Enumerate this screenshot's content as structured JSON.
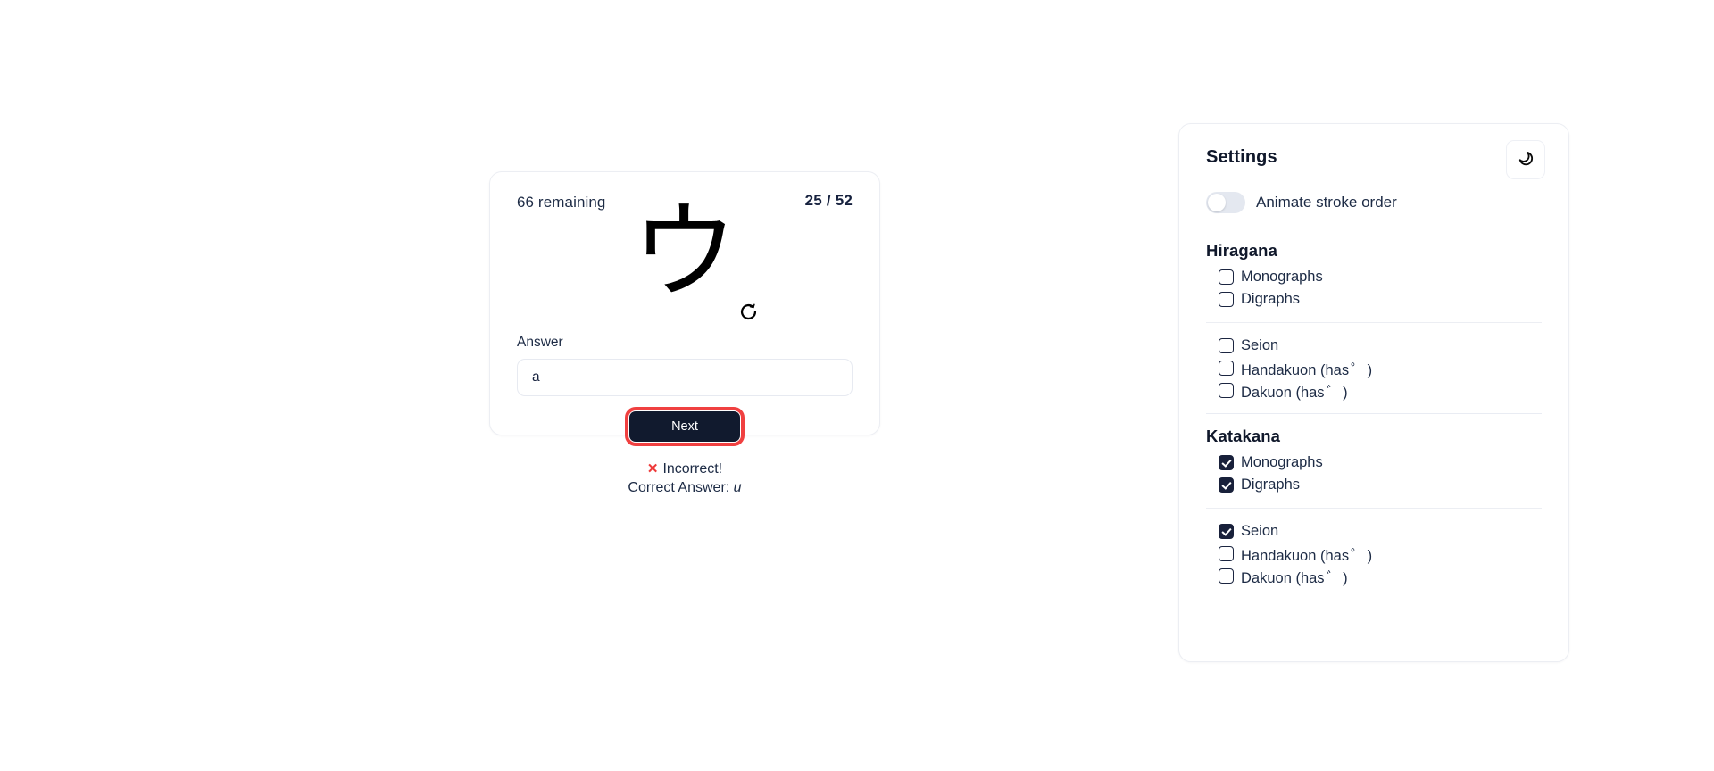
{
  "quiz": {
    "remaining_label": "66 remaining",
    "progress_label": "25 / 52",
    "character": "ウ",
    "replay_icon": "refresh-icon",
    "answer_label": "Answer",
    "answer_value": "a",
    "answer_placeholder": "",
    "next_label": "Next",
    "feedback": {
      "mark": "✕",
      "status": "Incorrect!",
      "correct_prefix": "Correct Answer:",
      "correct_value": "u"
    }
  },
  "settings": {
    "title": "Settings",
    "theme_icon": "moon-icon",
    "animate_toggle": {
      "label": "Animate stroke order",
      "checked": false
    },
    "sections": [
      {
        "title": "Hiragana",
        "group1": [
          {
            "label": "Monographs",
            "checked": false
          },
          {
            "label": "Digraphs",
            "checked": false
          }
        ],
        "group2": [
          {
            "label": "Seion",
            "checked": false
          },
          {
            "label_prefix": "Handakuon (has",
            "mark": "゜",
            "label_suffix": ")",
            "checked": false
          },
          {
            "label_prefix": "Dakuon (has",
            "mark": "゛",
            "label_suffix": ")",
            "checked": false
          }
        ]
      },
      {
        "title": "Katakana",
        "group1": [
          {
            "label": "Monographs",
            "checked": true
          },
          {
            "label": "Digraphs",
            "checked": true
          }
        ],
        "group2": [
          {
            "label": "Seion",
            "checked": true
          },
          {
            "label_prefix": "Handakuon (has",
            "mark": "゜",
            "label_suffix": ")",
            "checked": false
          },
          {
            "label_prefix": "Dakuon (has",
            "mark": "゛",
            "label_suffix": ")",
            "checked": false
          }
        ]
      }
    ]
  },
  "colors": {
    "accent_dark": "#111a2e",
    "highlight_red": "#f04040",
    "error_red": "#ee3a3a",
    "card_border": "#eceef3",
    "text": "#1d2b45"
  }
}
